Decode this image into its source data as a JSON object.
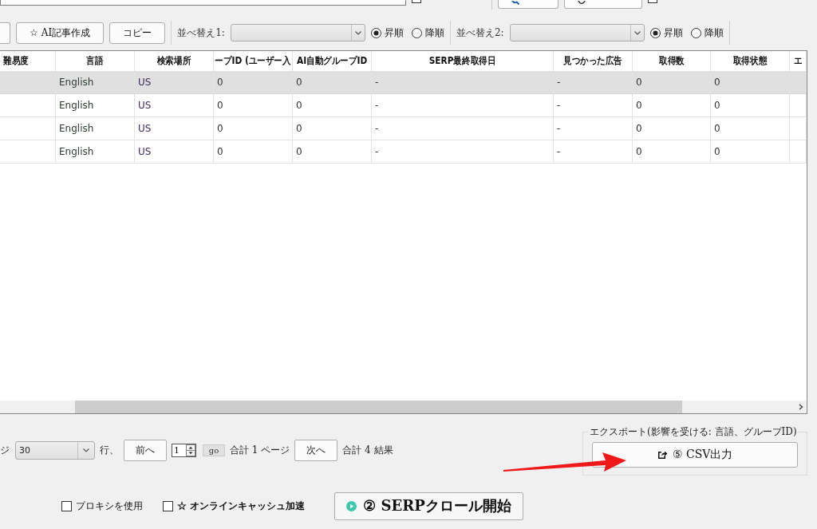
{
  "top_bar": {
    "checkboxes": [
      {
        "checked": false
      },
      {
        "checked": false
      }
    ],
    "buttons": [
      {
        "kind": "search"
      },
      {
        "kind": "circle"
      }
    ]
  },
  "toolbar": {
    "buttons": [
      {
        "kind": "cut"
      },
      {
        "kind": "text",
        "label": "☆ AI記事作成"
      },
      {
        "kind": "text",
        "label": "コピー"
      }
    ]
  },
  "sorts": [
    {
      "label": "並べ替え1:",
      "options": [
        {
          "label": "昇順",
          "selected": true
        },
        {
          "label": "降順",
          "selected": false
        }
      ]
    },
    {
      "label": "並べ替え2:",
      "options": [
        {
          "label": "昇順",
          "selected": true
        },
        {
          "label": "降順",
          "selected": false
        }
      ]
    }
  ],
  "table": {
    "columns": [
      "難易度",
      "言語",
      "検索場所",
      "ープID (ユーザー入",
      "AI自動グループID",
      "SERP最終取得日",
      "見つかった広告",
      "取得数",
      "取得状態",
      "エ"
    ],
    "rows": [
      {
        "selected": true,
        "cells": [
          "",
          "English",
          "US",
          "0",
          "0",
          "-",
          "-",
          "0",
          "0",
          ""
        ]
      },
      {
        "selected": false,
        "cells": [
          "",
          "English",
          "US",
          "0",
          "0",
          "-",
          "-",
          "0",
          "0",
          ""
        ]
      },
      {
        "selected": false,
        "cells": [
          "",
          "English",
          "US",
          "0",
          "0",
          "-",
          "-",
          "0",
          "0",
          ""
        ]
      },
      {
        "selected": false,
        "cells": [
          "",
          "English",
          "US",
          "0",
          "0",
          "-",
          "-",
          "0",
          "0",
          ""
        ]
      }
    ]
  },
  "pagination": {
    "page_size_label": "ジ",
    "page_size": "30",
    "rows_label": "行、",
    "prev": "前へ",
    "page": "1",
    "go": "go",
    "total_pages": "合計 1 ページ",
    "next": "次へ",
    "total_results": "合計 4 結果"
  },
  "export": {
    "title": "エクスポート(影響を受ける: 言語、グループID)",
    "button": "⑤ CSV出力"
  },
  "options": [
    {
      "kind": "plain",
      "label": "プロキシを使用",
      "checked": false
    },
    {
      "kind": "bold",
      "label": "☆ オンラインキャッシュ加速",
      "checked": false
    }
  ],
  "start_button": {
    "label": "② SERPクロール開始"
  }
}
